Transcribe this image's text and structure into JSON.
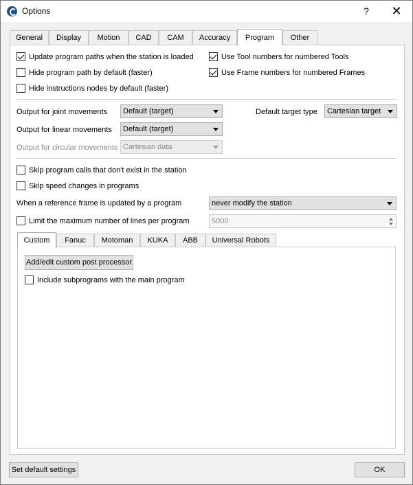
{
  "window": {
    "title": "Options",
    "help": "?",
    "close": "✕"
  },
  "tabs": [
    "General",
    "Display",
    "Motion",
    "CAD",
    "CAM",
    "Accuracy",
    "Program",
    "Other"
  ],
  "program": {
    "check_update_paths": "Update program paths when the station is loaded",
    "check_hide_path": "Hide program path by default (faster)",
    "check_hide_instructions": "Hide instructions nodes by default (faster)",
    "check_tool_numbers": "Use Tool numbers for numbered Tools",
    "check_frame_numbers": "Use Frame numbers for numbered Frames",
    "joint_label": "Output for joint movements",
    "joint_value": "Default (target)",
    "linear_label": "Output for linear movements",
    "linear_value": "Default (target)",
    "circular_label": "Output for circular movements",
    "circular_value": "Cartesian data",
    "target_type_label": "Default target type",
    "target_type_value": "Cartesian target",
    "check_skip_calls": "Skip program calls that don't exist in the station",
    "check_skip_speed": "Skip speed changes in programs",
    "ref_frame_label": "When a reference frame is updated by a program",
    "ref_frame_value": "never modify the station",
    "check_limit_lines": "Limit the maximum number of lines per program",
    "limit_lines_value": "5000"
  },
  "subtabs": [
    "Custom",
    "Fanuc",
    "Motoman",
    "KUKA",
    "ABB",
    "Universal Robots"
  ],
  "custom": {
    "add_edit_button": "Add/edit custom post processor",
    "check_include_subprograms": "Include subprograms with the main program"
  },
  "footer": {
    "default_button": "Set default settings",
    "ok_button": "OK"
  }
}
